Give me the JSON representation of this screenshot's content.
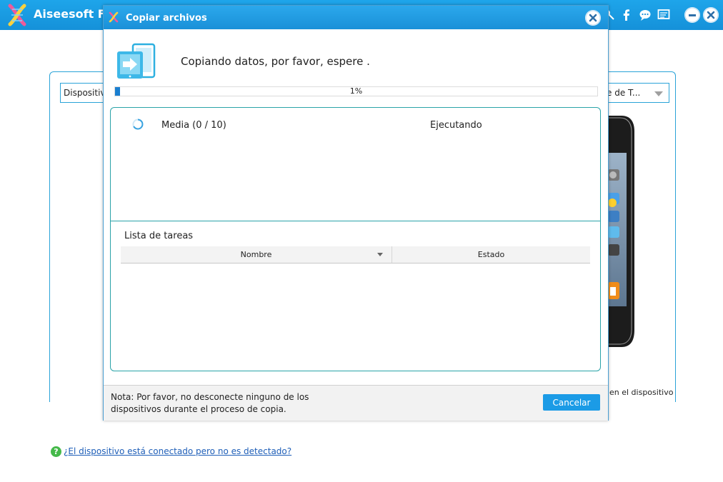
{
  "app": {
    "title": "Aiseesoft Fo",
    "header_icons": [
      "key-icon",
      "facebook-icon",
      "chat-icon",
      "feedback-icon"
    ],
    "window_buttons": [
      "minimize-icon",
      "close-icon"
    ]
  },
  "background": {
    "device_select_label": "Dispositivo",
    "target_select_label": "e de T...",
    "device_caption": "en el dispositivo",
    "help_link": "¿El dispositivo está conectado pero no es detectado?"
  },
  "dialog": {
    "title": "Copiar archivos",
    "status_message": "Copiando datos, por favor, espere .",
    "progress_percent": 1,
    "progress_text": "1%",
    "current_task": {
      "name": "Media (0 / 10)",
      "status": "Ejecutando"
    },
    "task_list": {
      "title": "Lista de tareas",
      "columns": [
        "Nombre",
        "Estado"
      ],
      "rows": []
    },
    "note": "Nota: Por favor, no desconecte ninguno de los dispositivos durante el proceso de copia.",
    "cancel_label": "Cancelar"
  },
  "colors": {
    "accent": "#1b9be6",
    "titlebar": "#1a90d8",
    "teal_border": "#2aa3a8",
    "progress_fill": "#1a7fd0"
  }
}
